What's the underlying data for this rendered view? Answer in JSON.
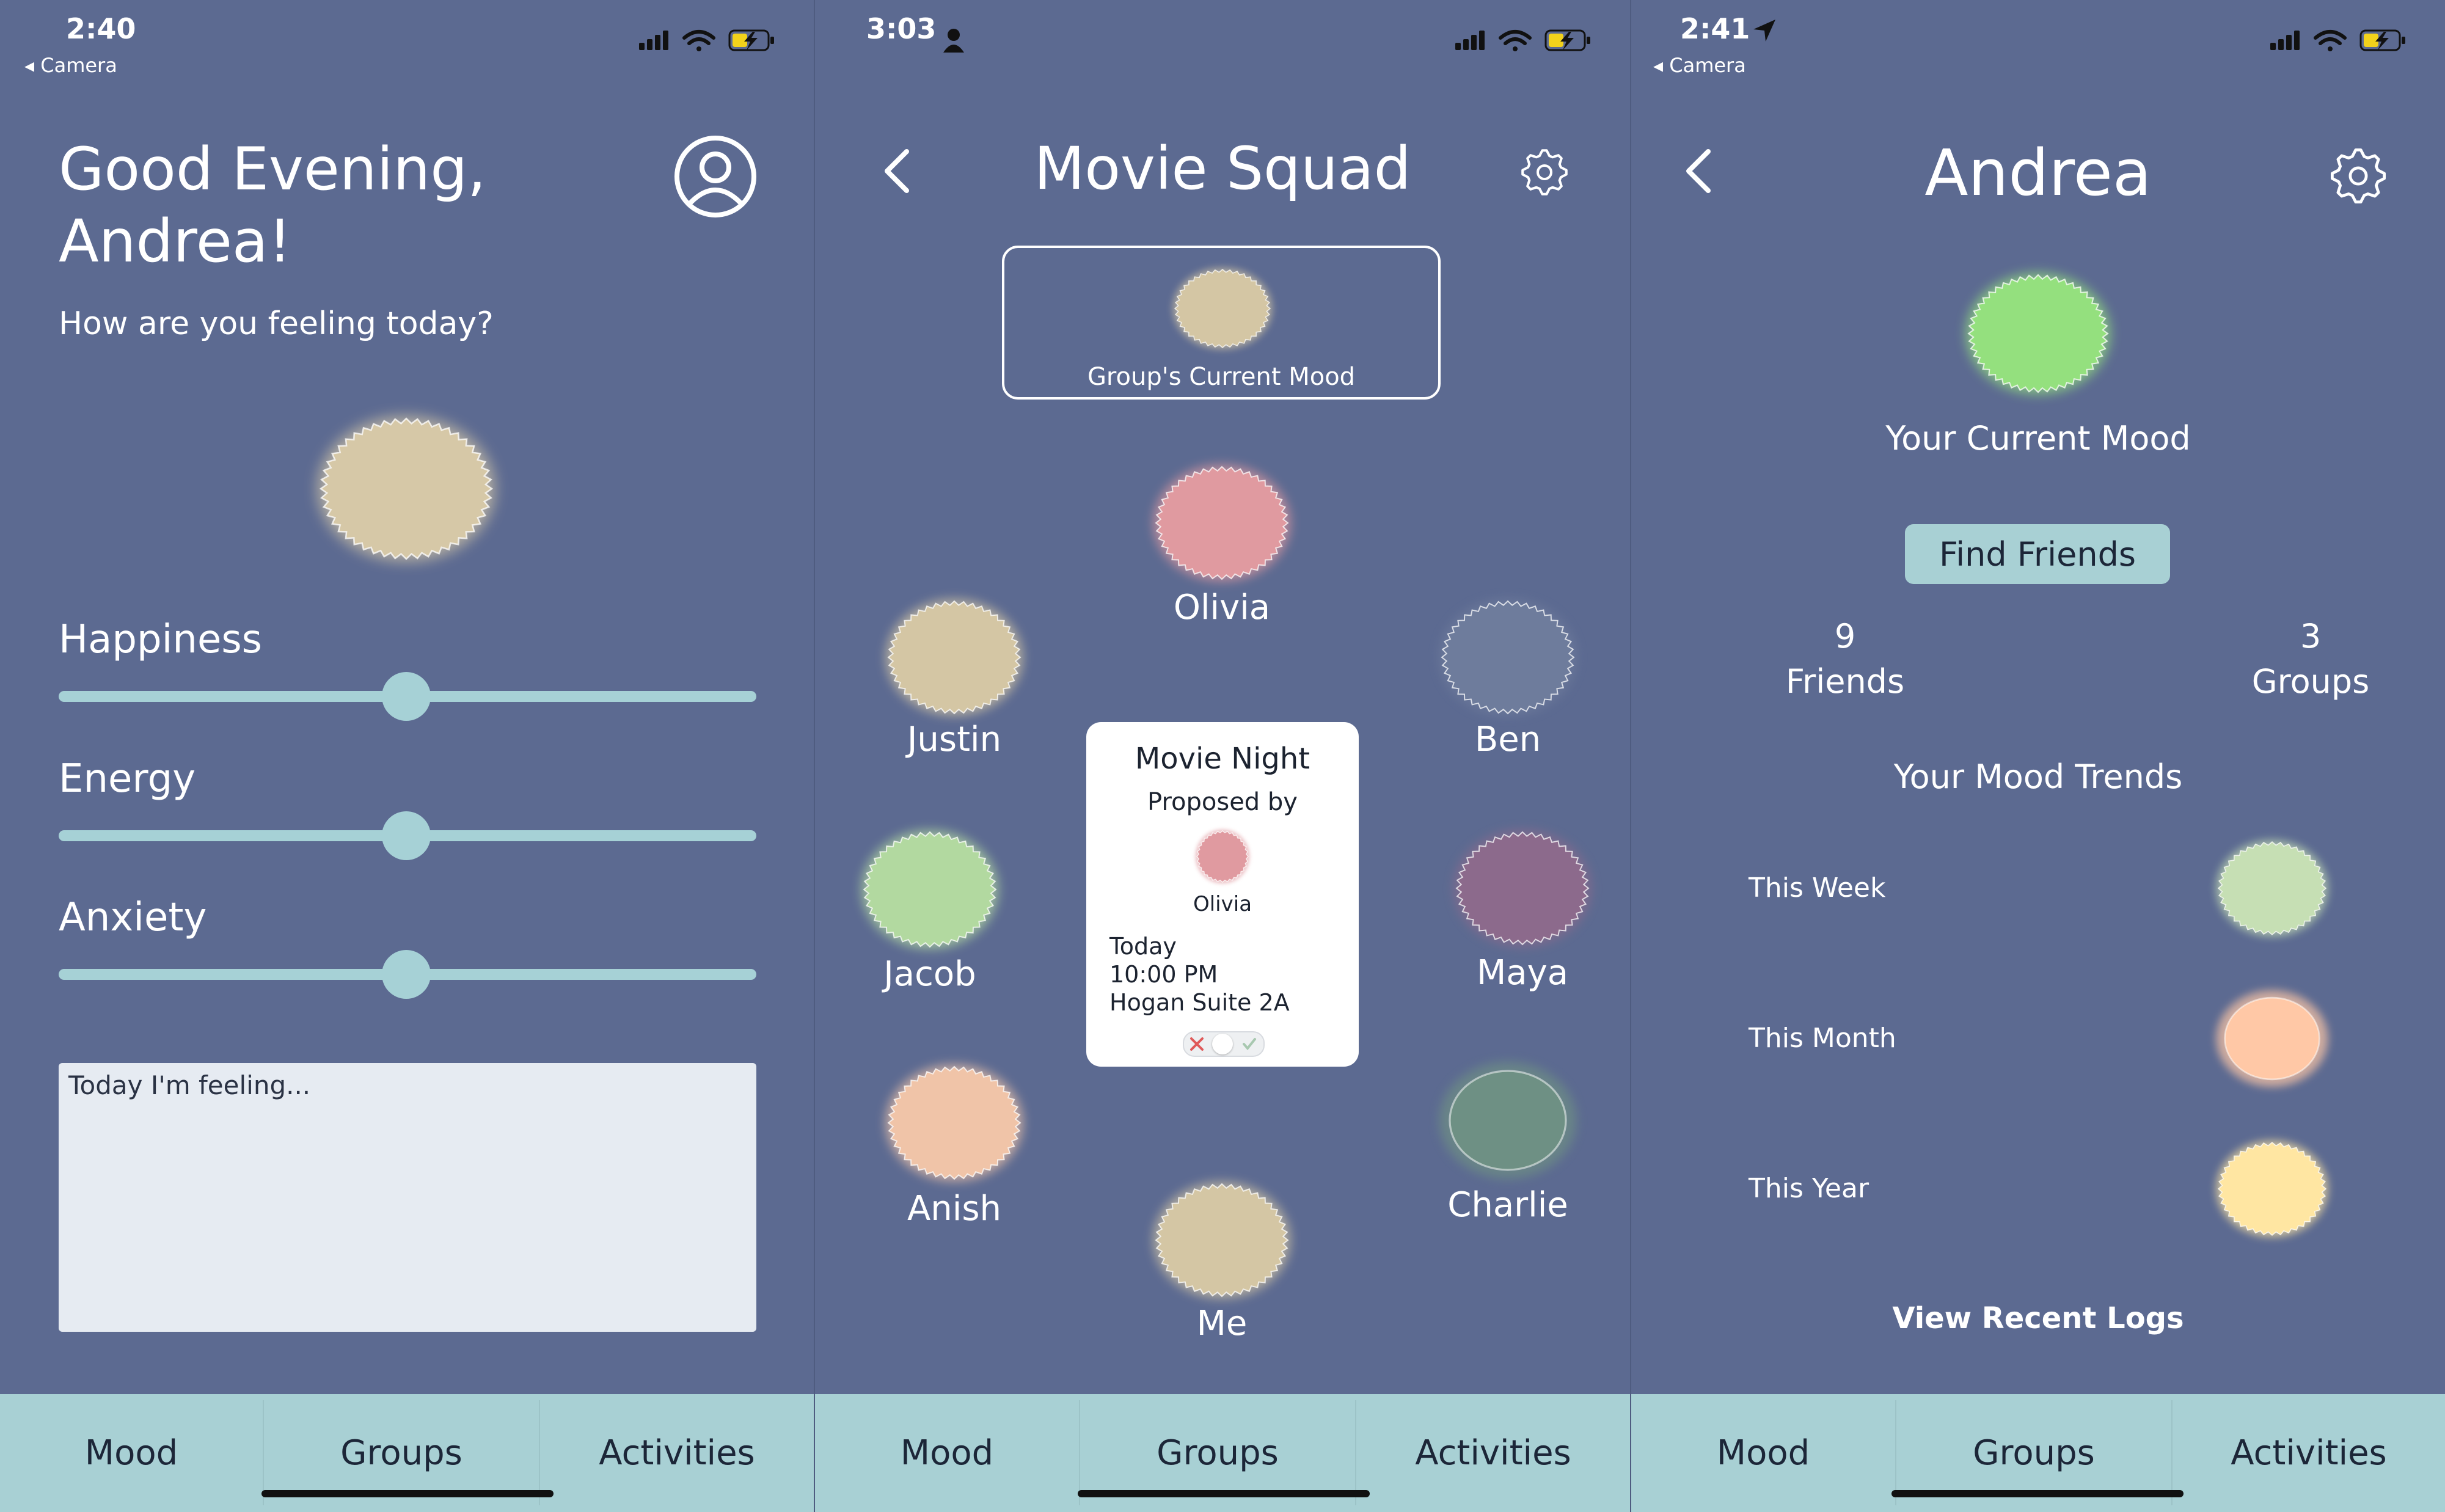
{
  "screen1": {
    "status": {
      "time": "2:40",
      "back_label": "◂ Camera"
    },
    "greeting_line1": "Good Evening,",
    "greeting_line2": "Andrea!",
    "prompt": "How are you feeling today?",
    "sliders": [
      {
        "label": "Happiness",
        "value": 0.5
      },
      {
        "label": "Energy",
        "value": 0.5
      },
      {
        "label": "Anxiety",
        "value": 0.5
      }
    ],
    "journal_placeholder": "Today I'm feeling...",
    "mood_color": "#d6c8a7"
  },
  "screen2": {
    "status": {
      "time": "3:03"
    },
    "title": "Movie Squad",
    "group_mood_label": "Group's Current Mood",
    "members": [
      {
        "name": "Olivia",
        "color": "#e09aa0"
      },
      {
        "name": "Justin",
        "color": "#d4c6a4"
      },
      {
        "name": "Ben",
        "color": "#6e7c9c"
      },
      {
        "name": "Jacob",
        "color": "#b2d9a0"
      },
      {
        "name": "Maya",
        "color": "#8c6a8c"
      },
      {
        "name": "Anish",
        "color": "#f0c4a8"
      },
      {
        "name": "Charlie",
        "color": "#6e9084"
      },
      {
        "name": "Me",
        "color": "#d4c6a4"
      }
    ],
    "event": {
      "title": "Movie Night",
      "proposed_by_label": "Proposed by",
      "proposer": "Olivia",
      "day": "Today",
      "time": "10:00 PM",
      "location": "Hogan Suite 2A"
    }
  },
  "screen3": {
    "status": {
      "time": "2:41",
      "back_label": "◂ Camera"
    },
    "title": "Andrea",
    "current_mood_label": "Your Current Mood",
    "find_friends_label": "Find Friends",
    "friends_count": "9",
    "friends_label": "Friends",
    "groups_count": "3",
    "groups_label": "Groups",
    "trends_title": "Your Mood Trends",
    "trends": [
      {
        "label": "This Week",
        "color": "#c6dfb4"
      },
      {
        "label": "This Month",
        "color": "#ffc8a6"
      },
      {
        "label": "This Year",
        "color": "#ffe6a2"
      }
    ],
    "view_logs_label": "View Recent Logs",
    "mood_color": "#94e07e"
  },
  "tabs": [
    "Mood",
    "Groups",
    "Activities"
  ],
  "colors": {
    "background": "#5c6a91",
    "accent": "#a8d0d4",
    "text": "#ffffff"
  }
}
